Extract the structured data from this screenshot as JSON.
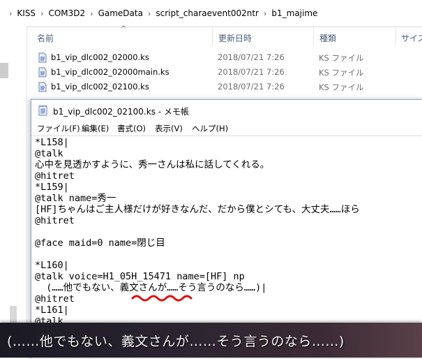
{
  "explorer": {
    "breadcrumb": [
      "KISS",
      "COM3D2",
      "GameData",
      "script_charaevent002ntr",
      "b1_majime"
    ],
    "columns": {
      "name": "名前",
      "date": "更新日時",
      "type": "種類",
      "size": "サイズ"
    },
    "files": [
      {
        "name": "b1_vip_dlc002_02000.ks",
        "date": "2018/07/21 7:26",
        "type": "KS ファイル"
      },
      {
        "name": "b1_vip_dlc002_02000main.ks",
        "date": "2018/07/21 7:26",
        "type": "KS ファイル"
      },
      {
        "name": "b1_vip_dlc002_02100.ks",
        "date": "2018/07/21 7:26",
        "type": "KS ファイル"
      }
    ]
  },
  "notepad": {
    "title": "b1_vip_dlc002_02100.ks - メモ帳",
    "menu": [
      "ファイル(F)",
      "編集(E)",
      "書式(O)",
      "表示(V)",
      "ヘルプ(H)"
    ],
    "lines": [
      "*L158|",
      "@talk",
      "心中を見透かすように、秀一さんは私に話してくれる。",
      "@hitret",
      "*L159|",
      "@talk name=秀一",
      "[HF]ちゃんはご主人様だけが好きなんだ、だから僕とシても、大丈夫……ほら",
      "@hitret",
      "",
      "@face maid=0 name=閉じ目",
      "",
      "*L160|",
      "@talk voice=H1_05H_15471 name=[HF] np",
      "  (……他でもない、義文さんが……そう言うのなら……)|",
      "@hitret",
      "*L161|",
      "@talk"
    ]
  },
  "subtitle": {
    "text": "(……他でもない、義文さんが……そう言うのなら……)"
  },
  "colors": {
    "squiggle": "#e01010",
    "header_text": "#4c607a"
  }
}
